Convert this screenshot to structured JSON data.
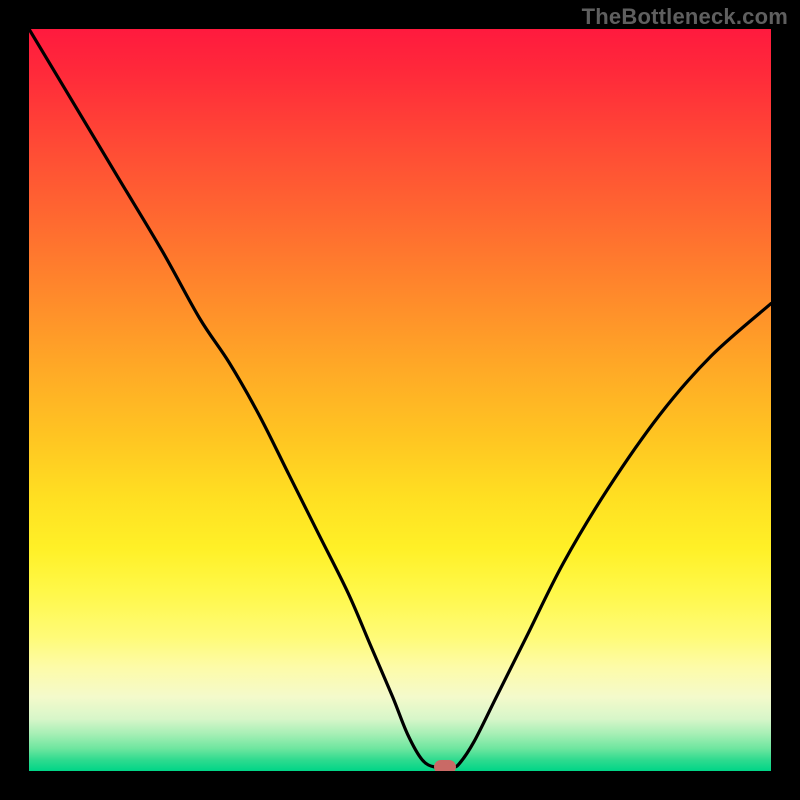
{
  "attribution": "TheBottleneck.com",
  "chart_data": {
    "type": "line",
    "title": "",
    "xlabel": "",
    "ylabel": "",
    "xlim": [
      0,
      100
    ],
    "ylim": [
      0,
      100
    ],
    "series": [
      {
        "name": "bottleneck-curve",
        "x": [
          0,
          6,
          12,
          18,
          23,
          27,
          31,
          35,
          39,
          43,
          46,
          49,
          51,
          53,
          54.8,
          57,
          58,
          60,
          63,
          67,
          72,
          78,
          85,
          92,
          100
        ],
        "values": [
          100,
          90,
          80,
          70,
          61,
          55,
          48,
          40,
          32,
          24,
          17,
          10,
          5,
          1.5,
          0.5,
          0.5,
          1,
          4,
          10,
          18,
          28,
          38,
          48,
          56,
          63
        ]
      }
    ],
    "marker": {
      "x": 56,
      "y": 0.5
    },
    "gradient_stops": [
      {
        "pos": 0,
        "color": "#ff1a3e"
      },
      {
        "pos": 50,
        "color": "#ffc522"
      },
      {
        "pos": 82,
        "color": "#fffb78"
      },
      {
        "pos": 100,
        "color": "#00d587"
      }
    ]
  }
}
